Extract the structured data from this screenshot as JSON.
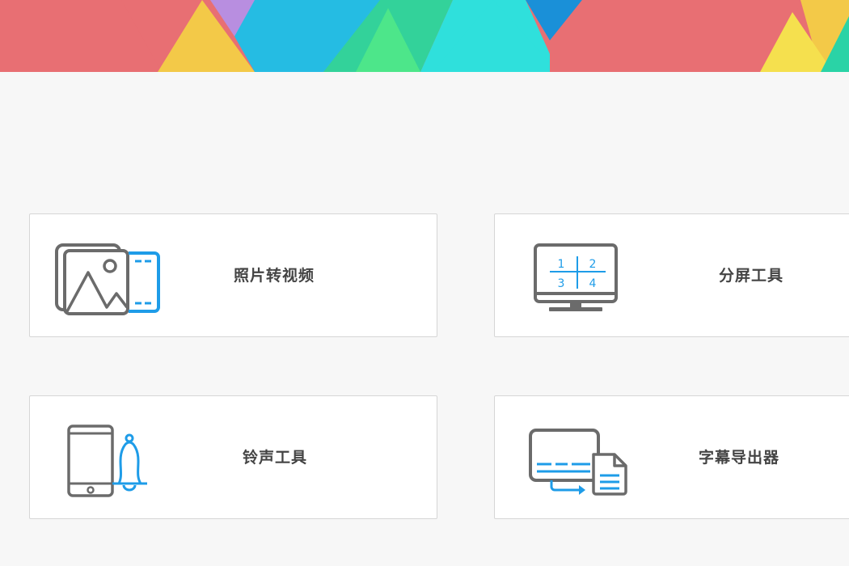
{
  "banner": {
    "palette": [
      "#e86f73",
      "#f3c948",
      "#b88ee0",
      "#25bce3",
      "#33d29a",
      "#4de68a",
      "#2fe0dc",
      "#1a90d8",
      "#f5e04e",
      "#2ad3a6"
    ]
  },
  "tools": [
    {
      "label": "照片转视频",
      "icon": "photo-to-video-icon"
    },
    {
      "label": "分屏工具",
      "icon": "split-screen-monitor-icon",
      "grid_numbers": [
        "1",
        "2",
        "3",
        "4"
      ]
    },
    {
      "label": "铃声工具",
      "icon": "phone-bell-icon"
    },
    {
      "label": "字幕导出器",
      "icon": "subtitle-export-icon"
    }
  ],
  "colors": {
    "icon_gray": "#6b6b6b",
    "icon_blue": "#1e9ce8",
    "label_text": "#444444"
  }
}
